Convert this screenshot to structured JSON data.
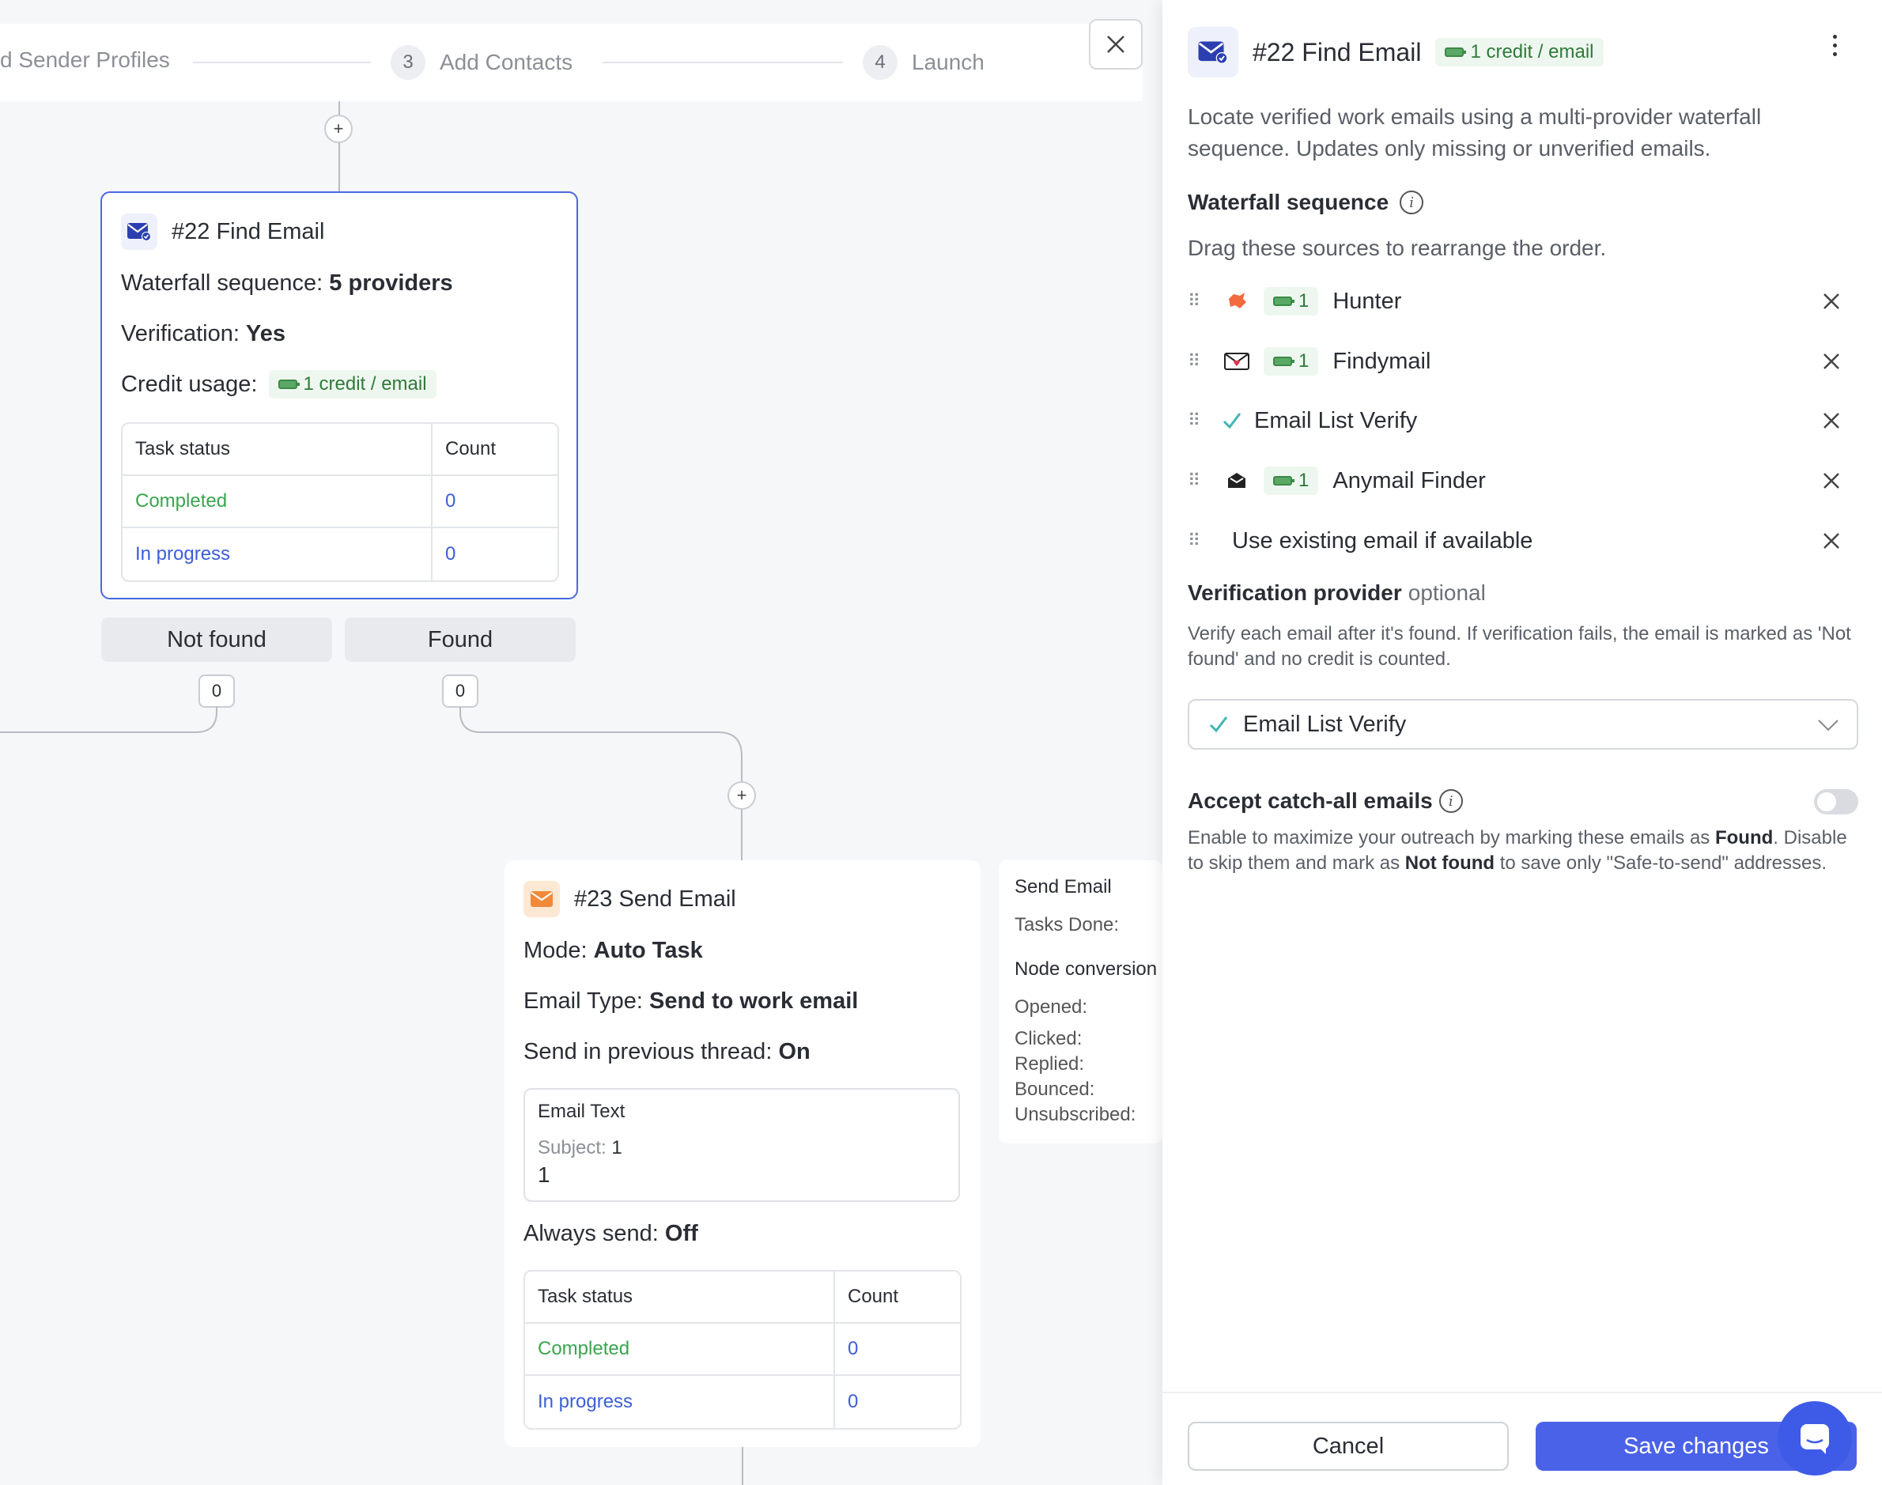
{
  "stepper": {
    "steps": [
      {
        "num": "",
        "label": "d Sender Profiles"
      },
      {
        "num": "3",
        "label": "Add Contacts"
      },
      {
        "num": "4",
        "label": "Launch"
      }
    ]
  },
  "canvas": {
    "find_node": {
      "title": "#22 Find Email",
      "waterfall_label": "Waterfall sequence:",
      "waterfall_value": "5 providers",
      "verification_label": "Verification:",
      "verification_value": "Yes",
      "credit_label": "Credit usage:",
      "credit_value": "1 credit / email",
      "table": {
        "headers": [
          "Task status",
          "Count"
        ],
        "rows": [
          {
            "status": "Completed",
            "count": "0"
          },
          {
            "status": "In progress",
            "count": "0"
          }
        ]
      }
    },
    "branches": {
      "not_found": "Not found",
      "found": "Found",
      "not_found_count": "0",
      "found_count": "0"
    },
    "send_node": {
      "title": "#23 Send Email",
      "mode_label": "Mode:",
      "mode_value": "Auto Task",
      "type_label": "Email Type:",
      "type_value": "Send to work email",
      "thread_label": "Send in previous thread:",
      "thread_value": "On",
      "email_text_title": "Email Text",
      "subject_label": "Subject:",
      "subject_value": "1",
      "body_value": "1",
      "always_label": "Always send:",
      "always_value": "Off",
      "table": {
        "headers": [
          "Task status",
          "Count"
        ],
        "rows": [
          {
            "status": "Completed",
            "count": "0"
          },
          {
            "status": "In progress",
            "count": "0"
          }
        ]
      }
    },
    "stats_card": {
      "title": "Send Email",
      "tasks_done": "Tasks Done:",
      "node_conversion": "Node conversion",
      "opened": "Opened:",
      "clicked": "Clicked:",
      "replied": "Replied:",
      "bounced": "Bounced:",
      "unsubscribed": "Unsubscribed:"
    }
  },
  "panel": {
    "title": "#22 Find Email",
    "credit_chip": "1 credit / email",
    "description": "Locate verified work emails using a multi-provider waterfall sequence. Updates only missing or unverified emails.",
    "waterfall_title": "Waterfall sequence",
    "waterfall_hint": "Drag these sources to rearrange the order.",
    "providers": [
      {
        "name": "Hunter",
        "credits": "1",
        "icon": "hunter-icon"
      },
      {
        "name": "Findymail",
        "credits": "1",
        "icon": "findymail-icon"
      },
      {
        "name": "Email List Verify",
        "credits": "",
        "icon": "checkmark-icon"
      },
      {
        "name": "Anymail Finder",
        "credits": "1",
        "icon": "anymail-icon"
      },
      {
        "name": "Use existing email if available",
        "credits": "",
        "icon": ""
      }
    ],
    "verification_title": "Verification provider",
    "verification_optional": "optional",
    "verification_desc": "Verify each email after it's found. If verification fails, the email is marked as 'Not found' and no credit is counted.",
    "verification_selected": "Email List Verify",
    "catchall_title": "Accept catch-all emails",
    "catchall_desc_1": "Enable to maximize your outreach by marking these emails as ",
    "catchall_found": "Found",
    "catchall_desc_2": ". Disable to skip them and mark as ",
    "catchall_not_found": "Not found",
    "catchall_desc_3": " to save only \"Safe-to-send\" addresses.",
    "catchall_enabled": false,
    "cancel_label": "Cancel",
    "save_label": "Save changes"
  },
  "colors": {
    "accent": "#4a62e8",
    "selected_border": "#4b67e0",
    "completed": "#3aa54d",
    "in_progress": "#3b5ed8",
    "credit_green": "#2f7a3a"
  }
}
